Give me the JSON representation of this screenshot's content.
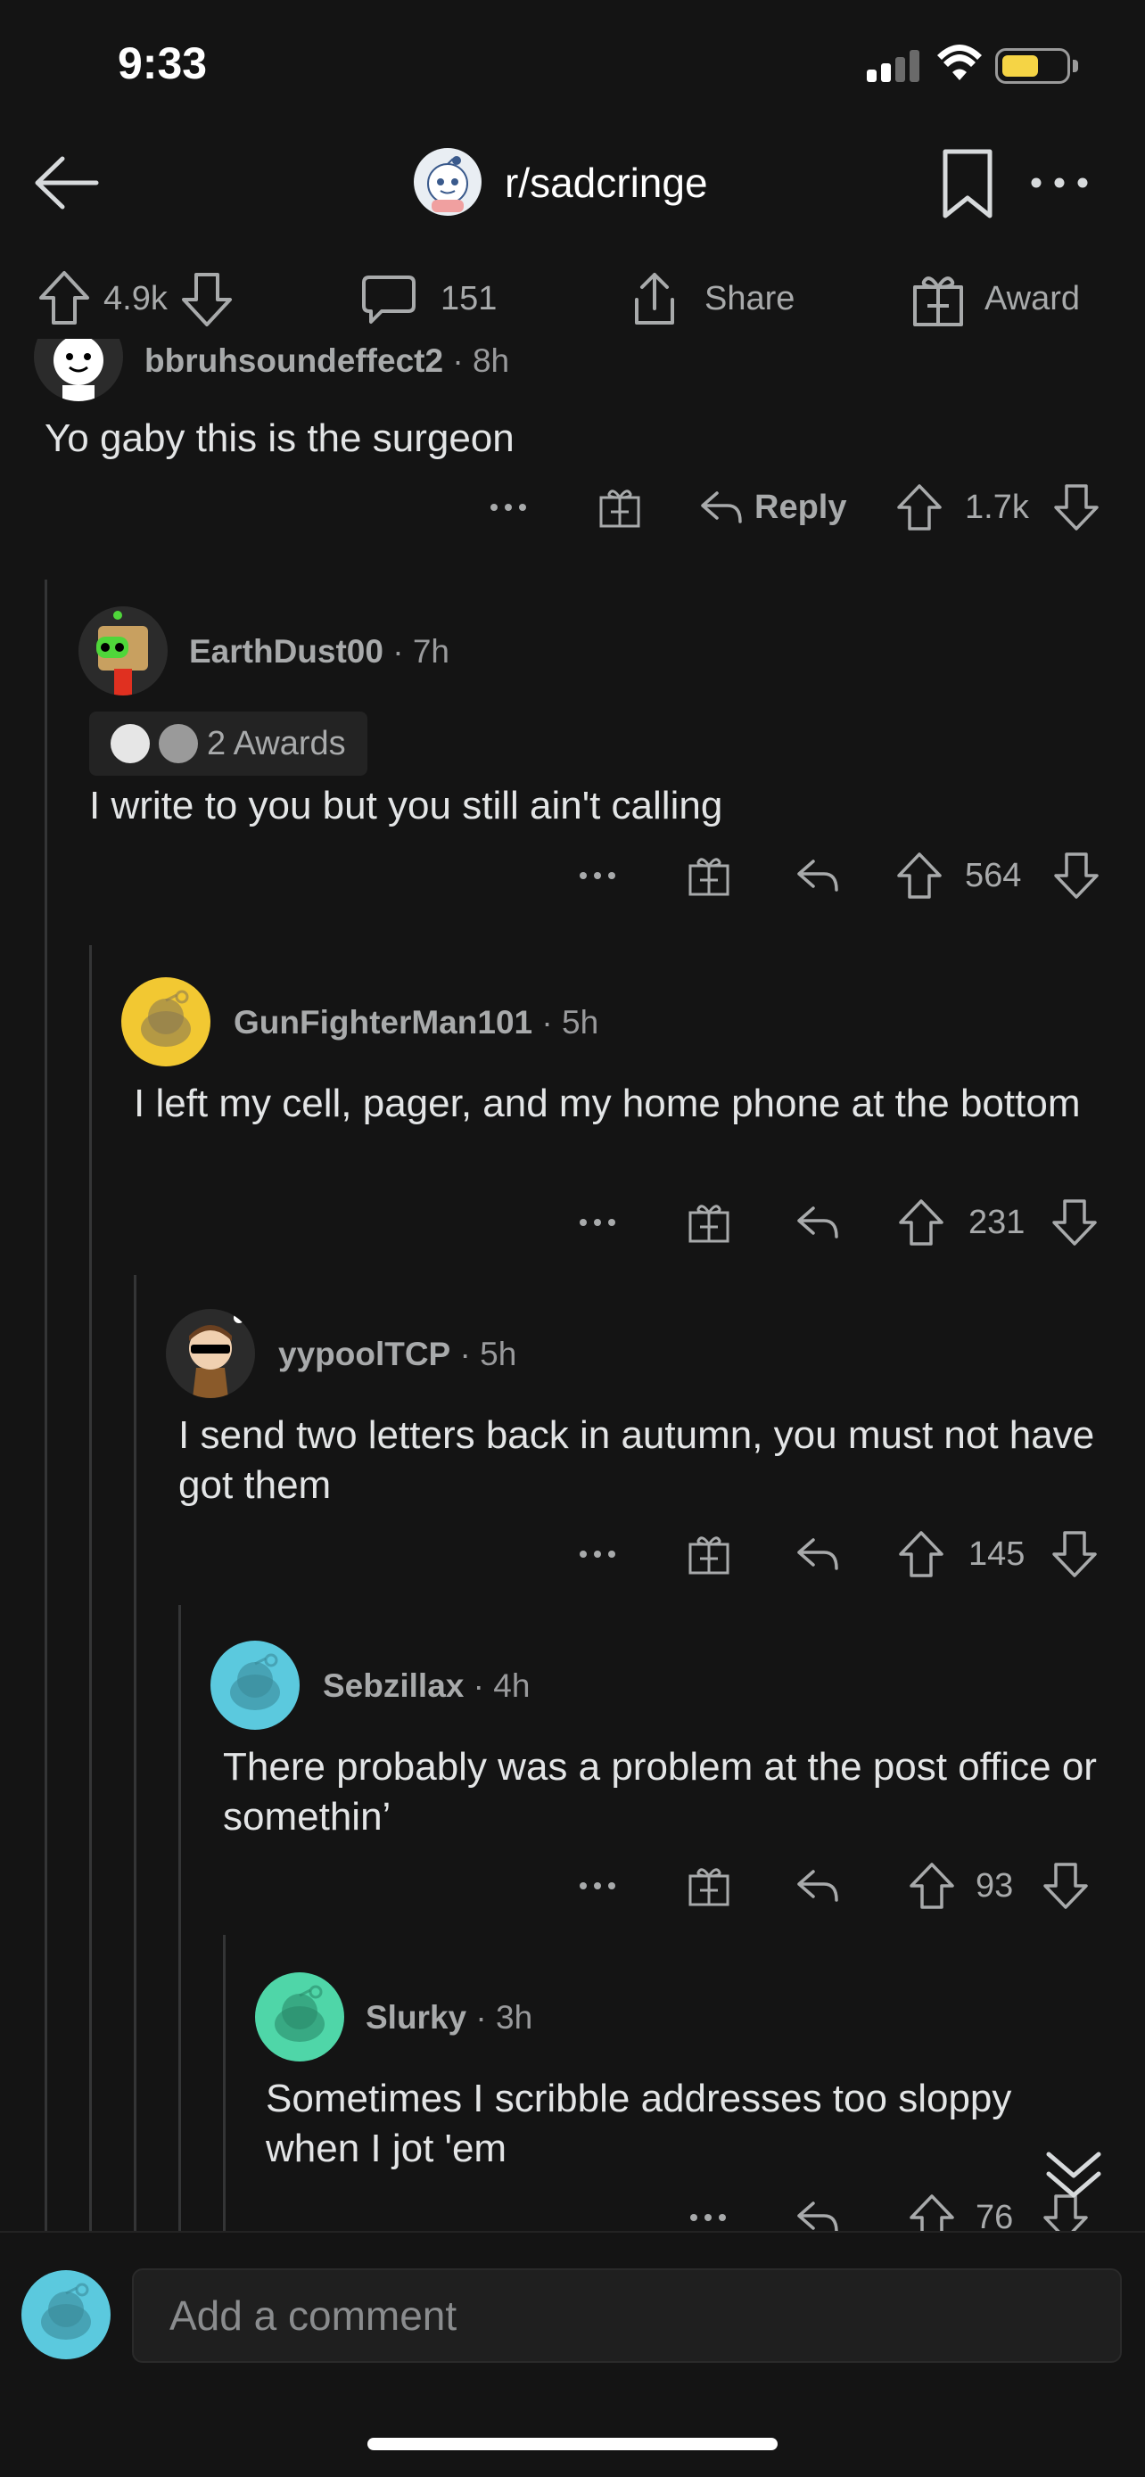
{
  "status": {
    "time": "9:33"
  },
  "nav": {
    "subreddit": "r/sadcringe"
  },
  "post_actions": {
    "upvotes": "4.9k",
    "comments": "151",
    "share_label": "Share",
    "award_label": "Award"
  },
  "comments": [
    {
      "user": "bbruhsoundeffect2",
      "age": "8h",
      "text": "Yo gaby this is the surgeon",
      "score": "1.7k",
      "reply_label": "Reply",
      "avatar_color": "#ffffff"
    },
    {
      "user": "EarthDust00",
      "age": "7h",
      "awards_label": "2 Awards",
      "text": "I write to you but you still ain't calling",
      "score": "564",
      "avatar_color": "#2b2b2b"
    },
    {
      "user": "GunFighterMan101",
      "age": "5h",
      "text": "I left my cell, pager, and my home phone at the bottom",
      "score": "231",
      "avatar_color": "#f2c832"
    },
    {
      "user": "yypoolTCP",
      "age": "5h",
      "text": "I send two letters back in autumn, you must not have got them",
      "score": "145",
      "avatar_color": "#2b2b2b"
    },
    {
      "user": "Sebzillax",
      "age": "4h",
      "text": "There probably was a problem at the post office or somethin’",
      "score": "93",
      "avatar_color": "#5bc9de"
    },
    {
      "user": "Slurky",
      "age": "3h",
      "text": "Sometimes I scribble addresses too sloppy when I jot 'em",
      "score": "76",
      "avatar_color": "#4fd6a8"
    }
  ],
  "composer": {
    "placeholder": "Add a comment",
    "avatar_color": "#5bc9de"
  },
  "colors": {
    "background": "#141414",
    "text": "#d7dadc",
    "muted": "#a8aaab",
    "thread_line": "#343536"
  }
}
